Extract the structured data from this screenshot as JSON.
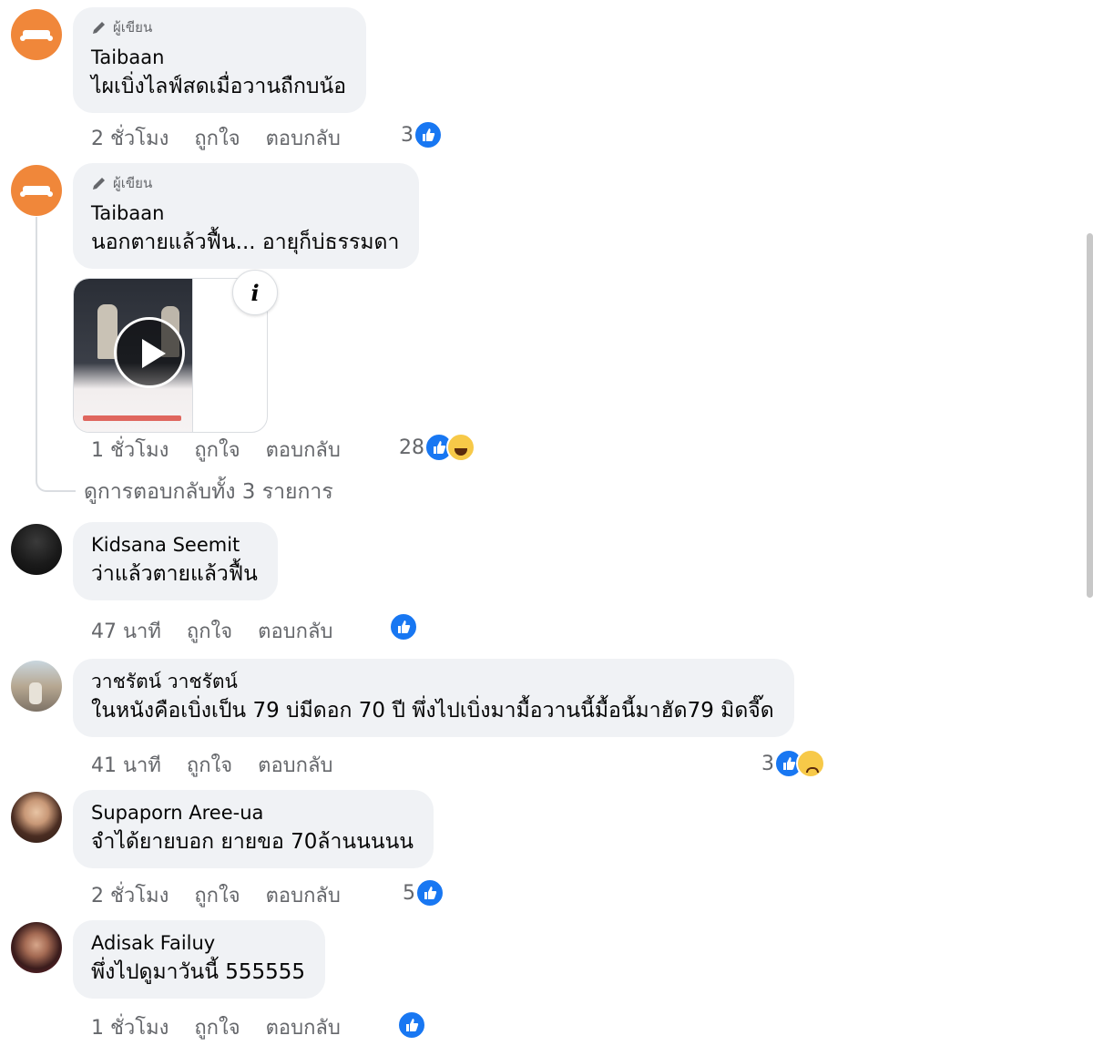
{
  "comments": [
    {
      "author_badge": "ผู้เขียน",
      "name": "Taibaan",
      "text": "ไผเบิ่งไลฟ์สดเมื่อวานถืกบน้อ",
      "time": "2 ชั่วโมง",
      "like": "ถูกใจ",
      "reply": "ตอบกลับ",
      "reaction_count": "3"
    },
    {
      "author_badge": "ผู้เขียน",
      "name": "Taibaan",
      "text": "นอกตายแล้วฟื้น... อายุก็บ่ธรรมดา",
      "time": "1 ชั่วโมง",
      "like": "ถูกใจ",
      "reply": "ตอบกลับ",
      "reaction_count": "28"
    },
    {
      "name": "Kidsana Seemit",
      "text": "ว่าแล้วตายแล้วฟื้น",
      "time": "47 นาที",
      "like": "ถูกใจ",
      "reply": "ตอบกลับ",
      "reaction_count": ""
    },
    {
      "name": "วาชรัตน์ วาชรัตน์",
      "text": "ในหนังคือเบิ่งเป็น 79 บ่มีดอก 70 ปี พึ่งไปเบิ่งมามื้อวานนี้มื้อนี้มาฮัด79 มิดจี๊ด",
      "time": "41 นาที",
      "like": "ถูกใจ",
      "reply": "ตอบกลับ",
      "reaction_count": "3"
    },
    {
      "name": "Supaporn Aree-ua",
      "text": "จำได้ยายบอก ยายขอ 70ล้านนนนน",
      "time": "2 ชั่วโมง",
      "like": "ถูกใจ",
      "reply": "ตอบกลับ",
      "reaction_count": "5"
    },
    {
      "name": "Adisak Failuy",
      "text": "พึ่งไปดูมาวันนี้ 555555",
      "time": "1 ชั่วโมง",
      "like": "ถูกใจ",
      "reply": "ตอบกลับ",
      "reaction_count": ""
    }
  ],
  "view_replies": "ดูการตอบกลับทั้ง 3 รายการ",
  "info_icon": "i",
  "icons": {
    "like": "like-icon",
    "haha": "haha-icon",
    "sad": "sad-icon",
    "pencil": "pencil-icon",
    "play": "play-icon",
    "info": "info-icon"
  },
  "colors": {
    "bubble_bg": "#f0f2f5",
    "meta_text": "#65676b",
    "like_blue": "#1877f2",
    "brand_orange": "#f0873a"
  }
}
